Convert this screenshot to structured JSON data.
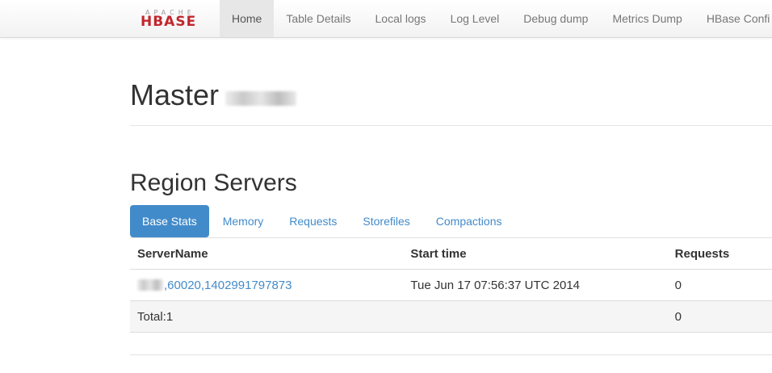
{
  "brand": {
    "top": "APACHE",
    "main": "HBASE",
    "color": "#c2272d"
  },
  "nav": {
    "items": [
      {
        "label": "Home",
        "active": true
      },
      {
        "label": "Table Details"
      },
      {
        "label": "Local logs"
      },
      {
        "label": "Log Level"
      },
      {
        "label": "Debug dump"
      },
      {
        "label": "Metrics Dump"
      },
      {
        "label": "HBase Confi"
      }
    ]
  },
  "header": {
    "title": "Master"
  },
  "region_servers": {
    "title": "Region Servers",
    "tabs": [
      {
        "label": "Base Stats",
        "active": true
      },
      {
        "label": "Memory"
      },
      {
        "label": "Requests"
      },
      {
        "label": "Storefiles"
      },
      {
        "label": "Compactions"
      }
    ],
    "columns": [
      "ServerName",
      "Start time",
      "Requests"
    ],
    "rows": [
      {
        "server": ",60020,1402991797873",
        "start_time": "Tue Jun 17 07:56:37 UTC 2014",
        "requests": "0"
      }
    ],
    "total": {
      "label": "Total:1",
      "start_time": "",
      "requests": "0"
    }
  },
  "colors": {
    "accent": "#428bca",
    "nav_text": "#777777",
    "nav_active_bg": "#e7e7e7"
  }
}
